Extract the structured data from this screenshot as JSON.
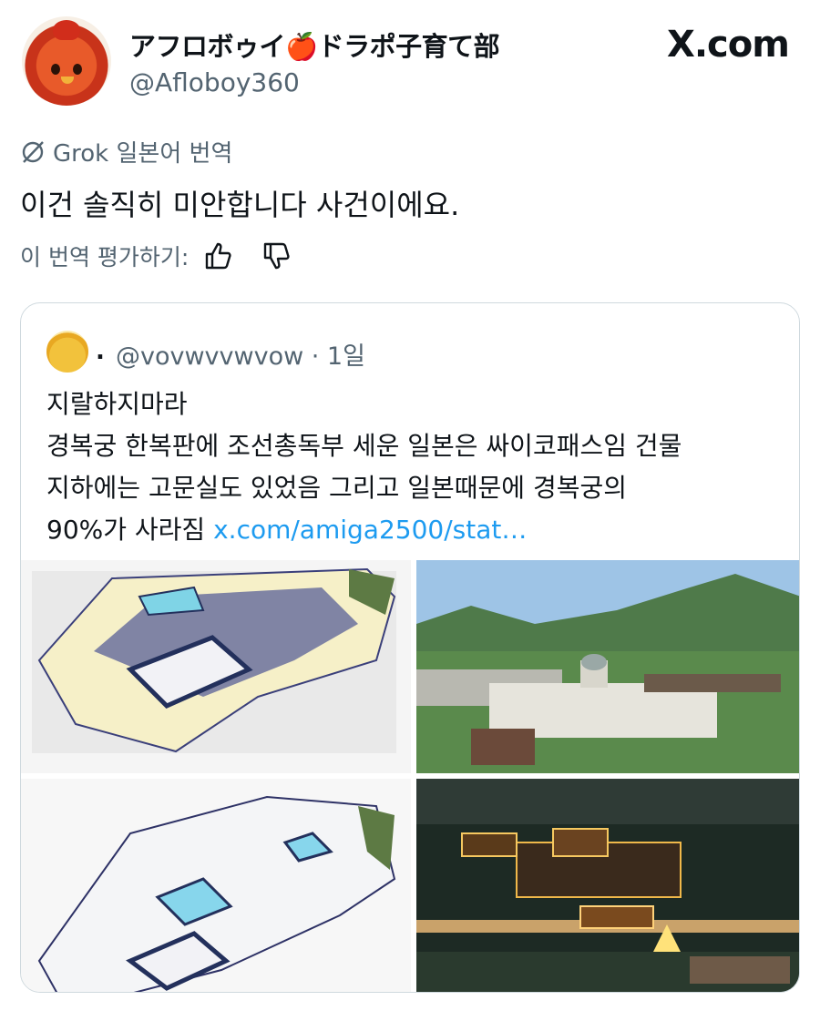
{
  "header": {
    "display_name": "アフロボゥイ🍎ドラポ子育て部",
    "handle": "@Afloboy360",
    "watermark": "X.com"
  },
  "translation": {
    "label": "Grok 일본어 번역",
    "text": "이건 솔직히 미안합니다 사건이에요.",
    "rate_label": "이 번역 평가하기:"
  },
  "quote": {
    "dot": ".",
    "handle_time": "@vovwvvwvow · 1일",
    "lines": [
      "지랄하지마라",
      "경복궁 한복판에 조선총독부 세운 일본은 싸이코패스임 건물",
      "지하에는 고문실도 있었음 그리고 일본때문에 경복궁의",
      "90%가 사라짐"
    ],
    "link": "x.com/amiga2500/stat…"
  },
  "images": {
    "top_left": "palace-map-full",
    "top_right": "palace-aerial-day",
    "bottom_left": "palace-map-remaining",
    "bottom_right": "palace-aerial-night"
  },
  "colors": {
    "text": "#0f1419",
    "secondary": "#536471",
    "link": "#1d9bf0",
    "border": "#cfd9de"
  }
}
